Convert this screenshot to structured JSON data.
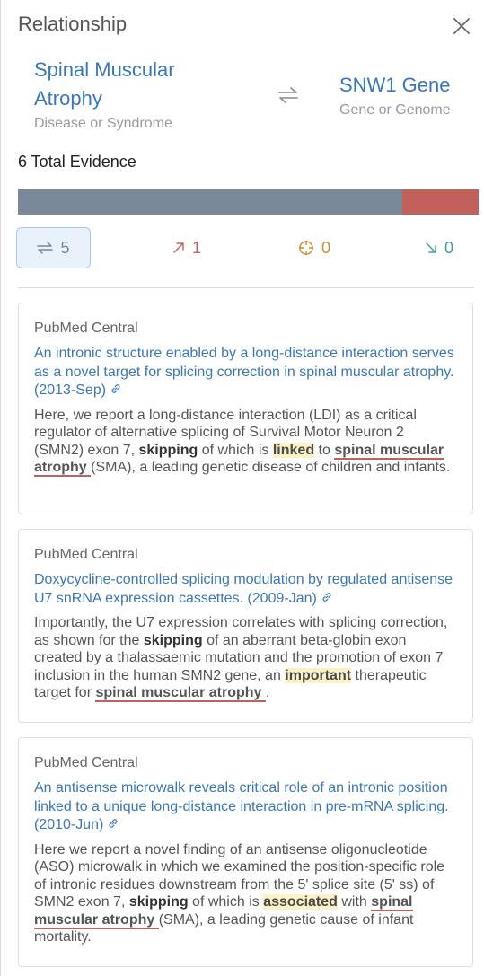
{
  "header": {
    "title": "Relationship",
    "close_icon": "close-icon"
  },
  "entities": {
    "source": {
      "name": "Spinal Muscular Atrophy",
      "type": "Disease or Syndrome"
    },
    "relation_icon": "bidirectional-arrows-icon",
    "target": {
      "name": "SNW1 Gene",
      "type": "Gene or Genome"
    }
  },
  "evidence": {
    "total_label": "6 Total Evidence",
    "distribution": {
      "associated": 5,
      "positive": 1
    },
    "colors": {
      "associated": "#7a8899",
      "positive": "#c0625b",
      "neutral": "#d08a35",
      "negative": "#4a9a9a"
    }
  },
  "filters": [
    {
      "name": "associated",
      "icon": "bidirectional-arrows-icon",
      "count": "5",
      "active": true
    },
    {
      "name": "positive",
      "icon": "arrow-up-right-icon",
      "count": "1",
      "active": false
    },
    {
      "name": "neutral",
      "icon": "crosshair-icon",
      "count": "0",
      "active": false
    },
    {
      "name": "negative",
      "icon": "arrow-down-right-icon",
      "count": "0",
      "active": false
    }
  ],
  "cards": [
    {
      "source": "PubMed Central",
      "title": "An intronic structure enabled by a long-distance interaction serves as a novel target for splicing correction in spinal muscular atrophy. (2013-Sep)",
      "body": {
        "t1": "Here, we report a long-distance interaction (LDI) as a critical regulator of alternative splicing of Survival Motor Neuron 2 (SMN2) exon 7, ",
        "k1": "skipping",
        "t2": " of which is ",
        "h1": "linked",
        "t3": " to ",
        "e1": "spinal muscular atrophy ",
        "t4": "(SMA), a leading genetic disease of children and infants."
      }
    },
    {
      "source": "PubMed Central",
      "title": "Doxycycline-controlled splicing modulation by regulated antisense U7 snRNA expression cassettes. (2009-Jan)",
      "body": {
        "t1": "Importantly, the U7 expression correlates with splicing correction, as shown for the ",
        "k1": "skipping",
        "t2": " of an aberrant beta-globin exon created by a thalassaemic mutation and the promotion of exon 7 inclusion in the human SMN2 gene, an ",
        "h1": "important",
        "t3": " therapeutic target for ",
        "e1": "spinal muscular atrophy ",
        "t4": "."
      }
    },
    {
      "source": "PubMed Central",
      "title": "An antisense microwalk reveals critical role of an intronic position linked to a unique long-distance interaction in pre-mRNA splicing. (2010-Jun)",
      "body": {
        "t1": "Here we report a novel finding of an antisense oligonucleotide (ASO) microwalk in which we examined the position-specific role of intronic residues downstream from the 5' splice site (5' ss) of SMN2 exon 7, ",
        "k1": "skipping",
        "t2": " of which is ",
        "h1": "associated",
        "t3": " with ",
        "e1": "spinal muscular atrophy ",
        "t4": "(SMA), a leading genetic cause of infant mortality."
      }
    }
  ]
}
